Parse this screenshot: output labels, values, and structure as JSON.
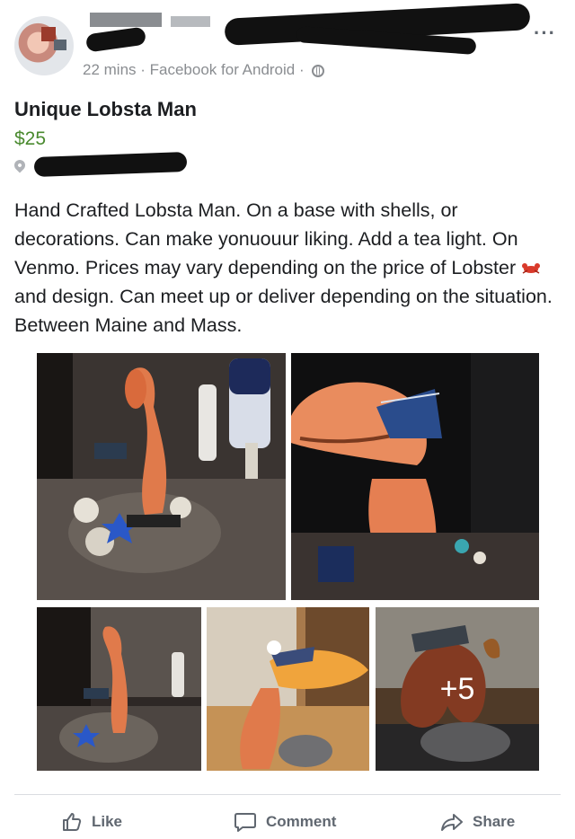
{
  "post": {
    "meta_time": "22 mins",
    "meta_sep1": " · ",
    "meta_source": "Facebook for Android",
    "meta_sep2": " · ",
    "more_icon": "···",
    "title": "Unique Lobsta Man",
    "price": "$25",
    "description_part1": "Hand Crafted Lobsta Man. On a base with shells, or decorations. Can make yonuouur liking. Add a tea light. On Venmo. Prices may vary depending on the price of Lobster ",
    "description_part2": " and design. Can meet up or deliver depending on the situation. Between Maine and Mass.",
    "more_photos_label": "+5"
  },
  "actions": {
    "like": "Like",
    "comment": "Comment",
    "share": "Share"
  },
  "icons": [
    "more-icon",
    "globe-icon",
    "location-pin-icon",
    "lobster-emoji",
    "like-icon",
    "comment-icon",
    "share-icon"
  ],
  "colors": {
    "price": "#4a8a2f",
    "meta": "#8a8d91",
    "action": "#606770"
  }
}
